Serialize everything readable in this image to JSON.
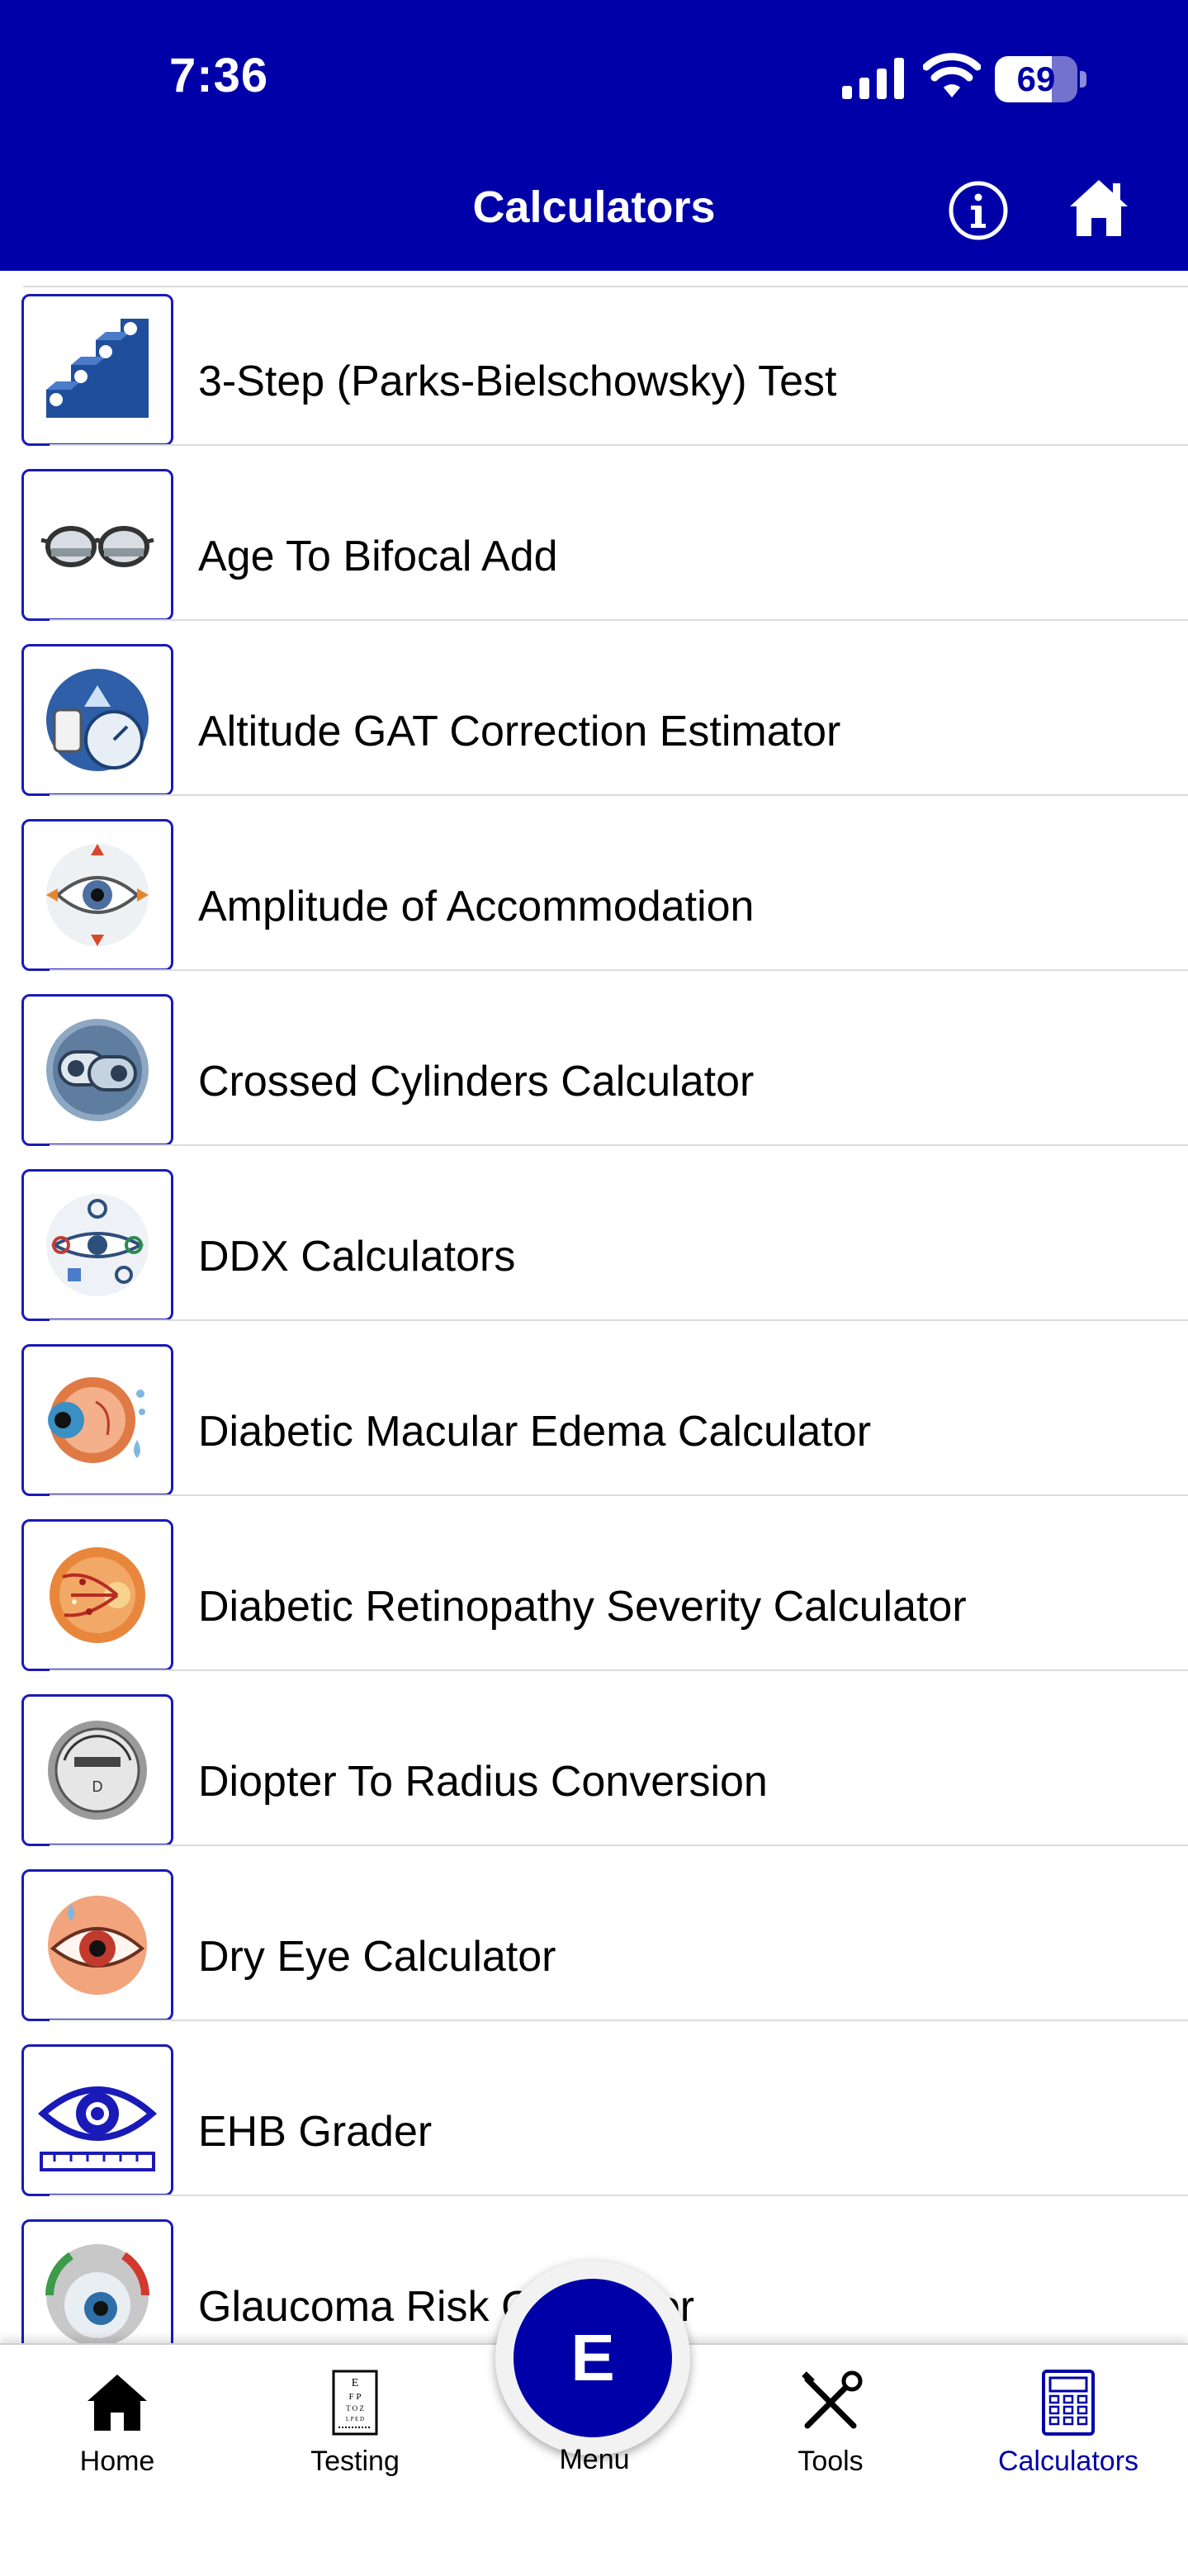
{
  "status_bar": {
    "time": "7:36",
    "battery": "69",
    "battery_level": 0.69
  },
  "header": {
    "title": "Calculators",
    "info_icon": "info-icon",
    "home_icon": "home-icon"
  },
  "calculators": [
    {
      "label": "3-Step (Parks-Bielschowsky) Test",
      "icon": "steps-icon"
    },
    {
      "label": "Age To Bifocal Add",
      "icon": "glasses-icon"
    },
    {
      "label": "Altitude GAT Correction Estimator",
      "icon": "altitude-gauge-icon"
    },
    {
      "label": "Amplitude of Accommodation",
      "icon": "eye-arrows-icon"
    },
    {
      "label": "Crossed Cylinders Calculator",
      "icon": "cylinders-icon"
    },
    {
      "label": "DDX Calculators",
      "icon": "ddx-icon"
    },
    {
      "label": "Diabetic Macular Edema Calculator",
      "icon": "eyeball-icon"
    },
    {
      "label": "Diabetic Retinopathy Severity Calculator",
      "icon": "retina-icon"
    },
    {
      "label": "Diopter To Radius Conversion",
      "icon": "diopter-dial-icon"
    },
    {
      "label": "Dry Eye Calculator",
      "icon": "dry-eye-icon"
    },
    {
      "label": "EHB Grader",
      "icon": "eye-ruler-icon"
    },
    {
      "label": "Glaucoma Risk Calculator",
      "icon": "glaucoma-eye-icon"
    }
  ],
  "tabbar": {
    "home": "Home",
    "testing": "Testing",
    "menu": "Menu",
    "menu_letter": "E",
    "tools": "Tools",
    "calculators": "Calculators",
    "active_tab": "calculators"
  },
  "colors": {
    "primary": "#0000a8",
    "icon_border": "#1a1ab8",
    "divider": "#dcdcdc"
  }
}
